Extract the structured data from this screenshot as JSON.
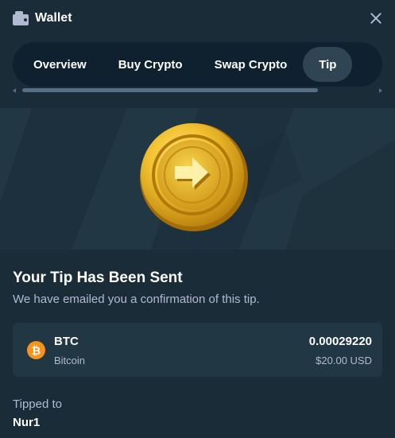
{
  "header": {
    "title": "Wallet",
    "wallet_icon": "wallet-icon",
    "close_icon": "close-icon"
  },
  "tabs": [
    {
      "label": "Overview",
      "active": false
    },
    {
      "label": "Buy Crypto",
      "active": false
    },
    {
      "label": "Swap Crypto",
      "active": false
    },
    {
      "label": "Tip",
      "active": true
    }
  ],
  "confirmation": {
    "headline": "Your Tip Has Been Sent",
    "message": "We have emailed you a confirmation of this tip."
  },
  "transaction": {
    "currency_symbol": "BTC",
    "currency_name": "Bitcoin",
    "currency_icon": "bitcoin-icon",
    "currency_glyph": "₿",
    "amount": "0.00029220",
    "fiat_value": "$20.00 USD"
  },
  "recipient": {
    "label": "Tipped to",
    "username": "Nur1"
  },
  "colors": {
    "background": "#1a2c38",
    "panel": "#213743",
    "tab_bar": "#0f212e",
    "active_tab": "#2f4553",
    "muted_text": "#b1bad3",
    "bitcoin": "#f7931a",
    "coin_gold": "#e8b923"
  }
}
